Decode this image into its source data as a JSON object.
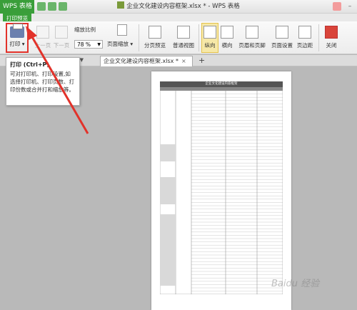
{
  "titlebar": {
    "app_name": "WPS 表格",
    "doc_title": "企业文化建设内容框架.xlsx * - WPS 表格"
  },
  "ribbon": {
    "active_tab": "打印预览",
    "print_label": "打印",
    "prev_page": "上一页",
    "next_page": "下一页",
    "zoom_label": "缩放比例",
    "zoom_value": "78 %",
    "page_zoom": "页面缩放",
    "page_break_preview": "分页预览",
    "normal_view": "普通视图",
    "portrait": "纵向",
    "landscape": "横向",
    "header_footer": "页眉和页脚",
    "page_setup": "页面设置",
    "margins": "页边距",
    "close": "关闭"
  },
  "doc_tab": {
    "label": "企业文化建设内容框架.xlsx *",
    "close": "×",
    "add": "+"
  },
  "tooltip": {
    "title": "打印 (Ctrl+P)",
    "body": "可对打印机、打印设置,如选择打印机、打印页数、打印份数或合并打和缩放等。"
  },
  "preview": {
    "sheet_title": "企业文化建设内容框架"
  },
  "watermark": "Baidu 经验",
  "colors": {
    "wps_green": "#3a9e3a",
    "highlight_red": "#e2322a"
  }
}
